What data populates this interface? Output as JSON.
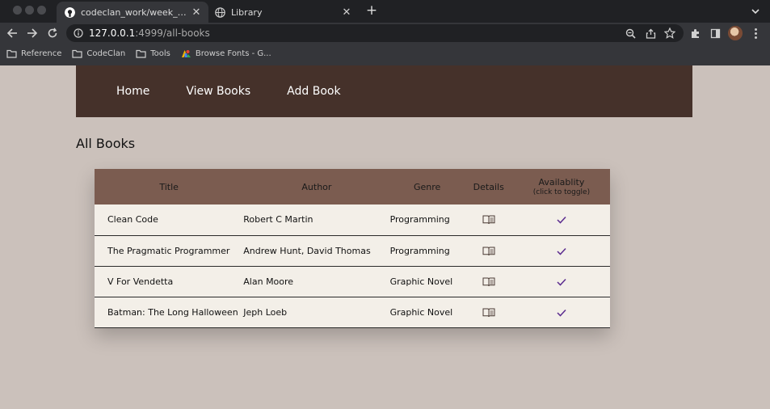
{
  "browser": {
    "tabs": [
      {
        "title": "codeclan_work/week_03/day_",
        "icon": "github-icon",
        "active": true
      },
      {
        "title": "Library",
        "icon": "globe-icon",
        "active": false
      }
    ],
    "url_host": "127.0.0.1",
    "url_path": ":4999/all-books",
    "bookmarks": [
      {
        "label": "Reference",
        "icon": "folder-icon"
      },
      {
        "label": "CodeClan",
        "icon": "folder-icon"
      },
      {
        "label": "Tools",
        "icon": "folder-icon"
      },
      {
        "label": "Browse Fonts - G...",
        "icon": "google-fonts-icon"
      }
    ]
  },
  "nav": {
    "items": [
      "Home",
      "View Books",
      "Add Book"
    ]
  },
  "page_title": "All Books",
  "table": {
    "headers": {
      "title": "Title",
      "author": "Author",
      "genre": "Genre",
      "details": "Details",
      "availability": "Availablity",
      "availability_hint": "(click to toggle)"
    },
    "rows": [
      {
        "title": "Clean Code",
        "author": "Robert C Martin",
        "genre": "Programming",
        "available": true
      },
      {
        "title": "The Pragmatic Programmer",
        "author": "Andrew Hunt, David Thomas",
        "genre": "Programming",
        "available": true
      },
      {
        "title": "V For Vendetta",
        "author": "Alan Moore",
        "genre": "Graphic Novel",
        "available": true
      },
      {
        "title": "Batman: The Long Halloween",
        "author": "Jeph Loeb",
        "genre": "Graphic Novel",
        "available": true
      }
    ]
  },
  "colors": {
    "nav_bg": "#45312a",
    "header_bg": "#7b5c50",
    "row_bg": "#f3efe8",
    "page_bg": "#cbc1bb",
    "check": "#5b2c8f"
  }
}
